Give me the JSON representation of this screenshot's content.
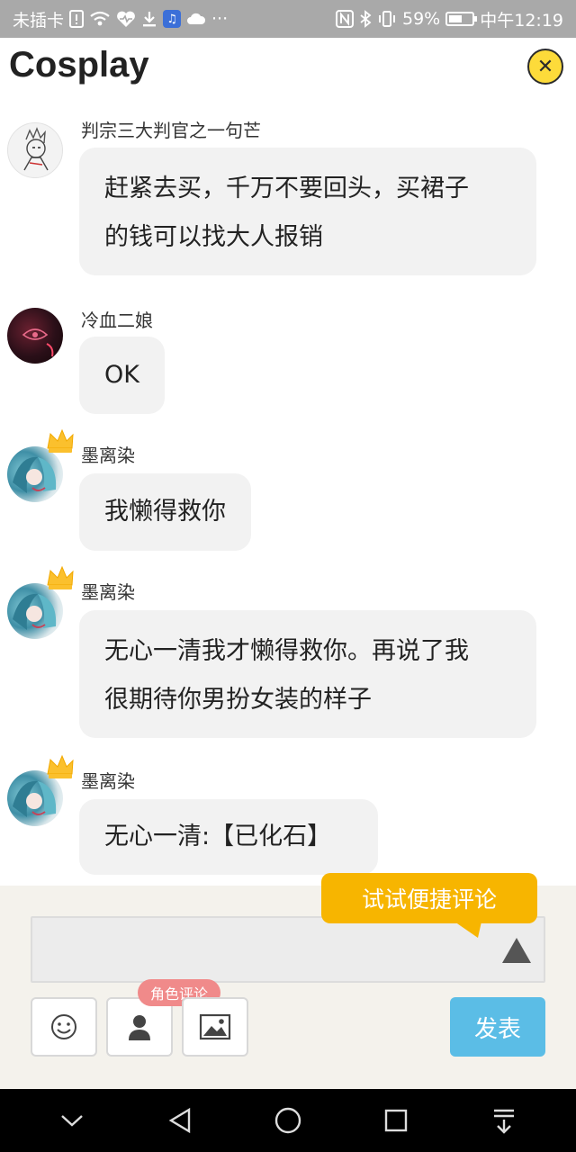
{
  "status_bar": {
    "carrier": "未插卡",
    "dots": "···",
    "battery_percent": "59%",
    "time": "中午12:19",
    "icons": [
      "sim-alert-icon",
      "wifi-icon",
      "heart-pulse-icon",
      "download-icon",
      "music-app-icon",
      "cloud-icon",
      "nfc-icon",
      "bluetooth-icon",
      "vibrate-icon",
      "battery-icon"
    ]
  },
  "header": {
    "title": "Cosplay",
    "close_icon": "close-icon",
    "close_symbol": "✕",
    "accent": "#fddb3a"
  },
  "messages": [
    {
      "username": "判宗三大判官之一句芒",
      "lines": [
        "赶紧去买，千万不要回头，买裙子",
        "的钱可以找大人报销"
      ],
      "avatar": "sketch",
      "crown": false
    },
    {
      "username": "冷血二娘",
      "lines": [
        "OK"
      ],
      "avatar": "dark",
      "crown": false
    },
    {
      "username": "墨离染",
      "lines": [
        "我懒得救你"
      ],
      "avatar": "anime",
      "crown": true
    },
    {
      "username": "墨离染",
      "lines": [
        "无心一清我才懒得救你。再说了我",
        "很期待你男扮女装的样子"
      ],
      "avatar": "anime",
      "crown": true
    },
    {
      "username": "墨离染",
      "lines": [
        "无心一清:【已化石】"
      ],
      "avatar": "anime",
      "crown": true
    }
  ],
  "composer": {
    "tip": "试试便捷评论",
    "input_value": "",
    "input_placeholder": "",
    "role_badge": "角色评论",
    "send_label": "发表",
    "tool_icons": [
      "emoji-icon",
      "person-icon",
      "image-icon"
    ],
    "colors": {
      "tip": "#f7b500",
      "send": "#5bbde6",
      "badge": "#f08a8a"
    }
  },
  "nav_bar": {
    "icons": [
      "chevron-down-icon",
      "back-icon",
      "home-icon",
      "recents-icon",
      "notification-drawer-icon"
    ]
  }
}
